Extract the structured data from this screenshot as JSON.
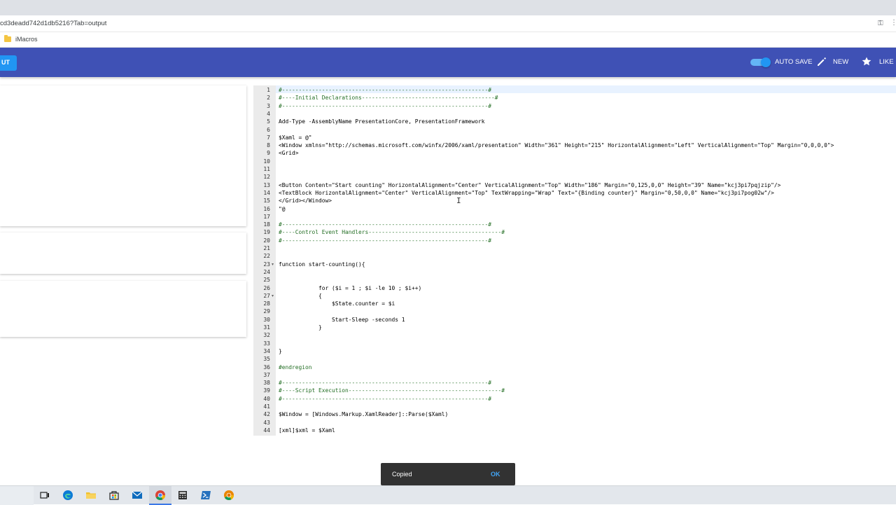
{
  "browser": {
    "url": "cd3deadd742d1db5216?Tab=output",
    "bookmark_label": "iMacros"
  },
  "header": {
    "run_label": "UT",
    "autosave_label": "AUTO SAVE",
    "new_label": "NEW",
    "like_label": "LIKE",
    "accent_color": "#3f51b5",
    "icons": [
      "toggle-switch",
      "pencil-icon",
      "star-icon"
    ]
  },
  "editor": {
    "lines": [
      {
        "n": "1",
        "text": "#--------------------------------------------------------------#",
        "cls": "c-cm"
      },
      {
        "n": "2",
        "text": "#----Initial Declarations----------------------------------------#",
        "cls": "c-cm"
      },
      {
        "n": "3",
        "text": "#--------------------------------------------------------------#",
        "cls": "c-cm"
      },
      {
        "n": "4",
        "text": "",
        "cls": "c-pl"
      },
      {
        "n": "5",
        "text": "Add-Type -AssemblyName PresentationCore, PresentationFramework",
        "cls": "c-pl"
      },
      {
        "n": "6",
        "text": "",
        "cls": "c-pl"
      },
      {
        "n": "7",
        "text": "$Xaml = @\"",
        "cls": "c-pl"
      },
      {
        "n": "8",
        "text": "<Window xmlns=\"http://schemas.microsoft.com/winfx/2006/xaml/presentation\" Width=\"361\" Height=\"215\" HorizontalAlignment=\"Left\" VerticalAlignment=\"Top\" Margin=\"0,0,0,0\">",
        "cls": "c-pl"
      },
      {
        "n": "9",
        "text": "<Grid>",
        "cls": "c-pl"
      },
      {
        "n": "10",
        "text": "",
        "cls": "c-pl"
      },
      {
        "n": "11",
        "text": "",
        "cls": "c-pl"
      },
      {
        "n": "12",
        "text": "",
        "cls": "c-pl"
      },
      {
        "n": "13",
        "text": "<Button Content=\"Start counting\" HorizontalAlignment=\"Center\" VerticalAlignment=\"Top\" Width=\"186\" Margin=\"0,125,0,0\" Height=\"39\" Name=\"kcj3pi7pqjzip\"/>",
        "cls": "c-pl"
      },
      {
        "n": "14",
        "text": "<TextBlock HorizontalAlignment=\"Center\" VerticalAlignment=\"Top\" TextWrapping=\"Wrap\" Text=\"{Binding counter}\" Margin=\"0,50,0,0\" Name=\"kcj3pi7pog02w\"/>",
        "cls": "c-pl"
      },
      {
        "n": "15",
        "text": "</Grid></Window>",
        "cls": "c-pl"
      },
      {
        "n": "16",
        "text": "\"@",
        "cls": "c-pl"
      },
      {
        "n": "17",
        "text": "",
        "cls": "c-pl"
      },
      {
        "n": "18",
        "text": "#--------------------------------------------------------------#",
        "cls": "c-cm"
      },
      {
        "n": "19",
        "text": "#----Control Event Handlers----------------------------------------#",
        "cls": "c-cm"
      },
      {
        "n": "20",
        "text": "#--------------------------------------------------------------#",
        "cls": "c-cm"
      },
      {
        "n": "21",
        "text": "",
        "cls": "c-pl"
      },
      {
        "n": "22",
        "text": "",
        "cls": "c-pl"
      },
      {
        "n": "23",
        "text": "function start-counting(){",
        "cls": "c-pl",
        "fold": true
      },
      {
        "n": "24",
        "text": "",
        "cls": "c-pl"
      },
      {
        "n": "25",
        "text": "",
        "cls": "c-pl"
      },
      {
        "n": "26",
        "text": "            for ($i = 1 ; $i -le 10 ; $i++)",
        "cls": "c-pl"
      },
      {
        "n": "27",
        "text": "            {",
        "cls": "c-pl",
        "fold": true
      },
      {
        "n": "28",
        "text": "                $State.counter = $i",
        "cls": "c-pl"
      },
      {
        "n": "29",
        "text": "",
        "cls": "c-pl"
      },
      {
        "n": "30",
        "text": "                Start-Sleep -seconds 1",
        "cls": "c-pl"
      },
      {
        "n": "31",
        "text": "            }",
        "cls": "c-pl"
      },
      {
        "n": "32",
        "text": "",
        "cls": "c-pl"
      },
      {
        "n": "33",
        "text": "",
        "cls": "c-pl"
      },
      {
        "n": "34",
        "text": "}",
        "cls": "c-pl"
      },
      {
        "n": "35",
        "text": "",
        "cls": "c-pl"
      },
      {
        "n": "36",
        "text": "#endregion",
        "cls": "c-cm"
      },
      {
        "n": "37",
        "text": "",
        "cls": "c-pl"
      },
      {
        "n": "38",
        "text": "#--------------------------------------------------------------#",
        "cls": "c-cm"
      },
      {
        "n": "39",
        "text": "#----Script Execution----------------------------------------------#",
        "cls": "c-cm"
      },
      {
        "n": "40",
        "text": "#--------------------------------------------------------------#",
        "cls": "c-cm"
      },
      {
        "n": "41",
        "text": "",
        "cls": "c-pl"
      },
      {
        "n": "42",
        "text": "$Window = [Windows.Markup.XamlReader]::Parse($Xaml)",
        "cls": "c-pl"
      },
      {
        "n": "43",
        "text": "",
        "cls": "c-pl"
      },
      {
        "n": "44",
        "text": "[xml]$xml = $Xaml",
        "cls": "c-pl"
      }
    ]
  },
  "snackbar": {
    "message": "Copied",
    "action": "OK"
  },
  "taskbar": {
    "icons": [
      "task-view-icon",
      "edge-icon",
      "file-explorer-icon",
      "store-icon",
      "mail-icon",
      "chrome-icon",
      "calculator-icon",
      "powershell-icon",
      "chrome-alt-icon"
    ]
  }
}
